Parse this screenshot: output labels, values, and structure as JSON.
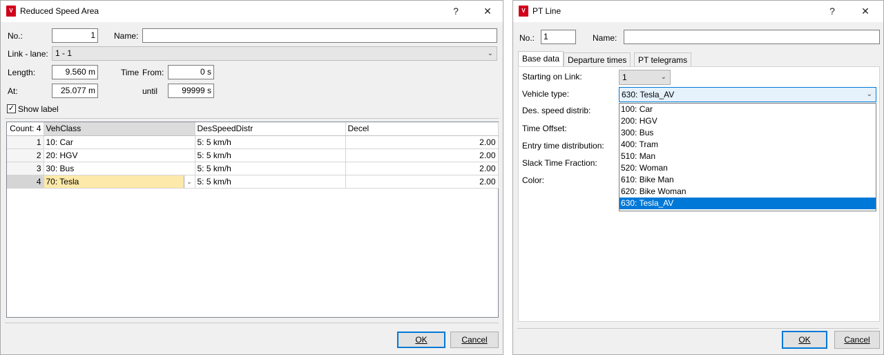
{
  "left_dialog": {
    "title": "Reduced Speed Area",
    "help": "?",
    "close": "✕",
    "no_label": "No.:",
    "no_value": "1",
    "name_label": "Name:",
    "name_value": "",
    "link_lane_label": "Link - lane:",
    "link_lane_value": "1 - 1",
    "length_label": "Length:",
    "length_value": "9.560 m",
    "time_label": "Time",
    "from_label": "From:",
    "from_value": "0 s",
    "at_label": "At:",
    "at_value": "25.077 m",
    "until_label": "until",
    "until_value": "99999 s",
    "show_label": "Show label",
    "show_label_checked": true,
    "table": {
      "count_header": "Count: 4",
      "columns": [
        "VehClass",
        "DesSpeedDistr",
        "Decel"
      ],
      "rows": [
        {
          "num": "1",
          "vehclass": "10: Car",
          "desspeed": "5: 5 km/h",
          "decel": "2.00"
        },
        {
          "num": "2",
          "vehclass": "20: HGV",
          "desspeed": "5: 5 km/h",
          "decel": "2.00"
        },
        {
          "num": "3",
          "vehclass": "30: Bus",
          "desspeed": "5: 5 km/h",
          "decel": "2.00"
        },
        {
          "num": "4",
          "vehclass": "70: Tesla",
          "desspeed": "5: 5 km/h",
          "decel": "2.00"
        }
      ]
    },
    "ok": "OK",
    "cancel": "Cancel"
  },
  "right_dialog": {
    "title": "PT Line",
    "help": "?",
    "close": "✕",
    "no_label": "No.:",
    "no_value": "1",
    "name_label": "Name:",
    "name_value": "",
    "tabs": [
      "Base data",
      "Departure times",
      "PT telegrams"
    ],
    "starting_on_link_label": "Starting on Link:",
    "starting_on_link_value": "1",
    "vehicle_type_label": "Vehicle type:",
    "vehicle_type_value": "630: Tesla_AV",
    "des_speed_label": "Des. speed distrib:",
    "time_offset_label": "Time Offset:",
    "entry_time_label": "Entry time distribution:",
    "slack_time_label": "Slack Time Fraction:",
    "color_label": "Color:",
    "dropdown_items": [
      "100: Car",
      "200: HGV",
      "300: Bus",
      "400: Tram",
      "510: Man",
      "520: Woman",
      "610: Bike Man",
      "620: Bike Woman",
      "630: Tesla_AV"
    ],
    "selected_item": "630: Tesla_AV",
    "ok": "OK",
    "cancel": "Cancel"
  },
  "colors": {
    "accent": "#0078d7",
    "edit_cell": "#fde9a9",
    "app_icon": "#d0021b"
  }
}
